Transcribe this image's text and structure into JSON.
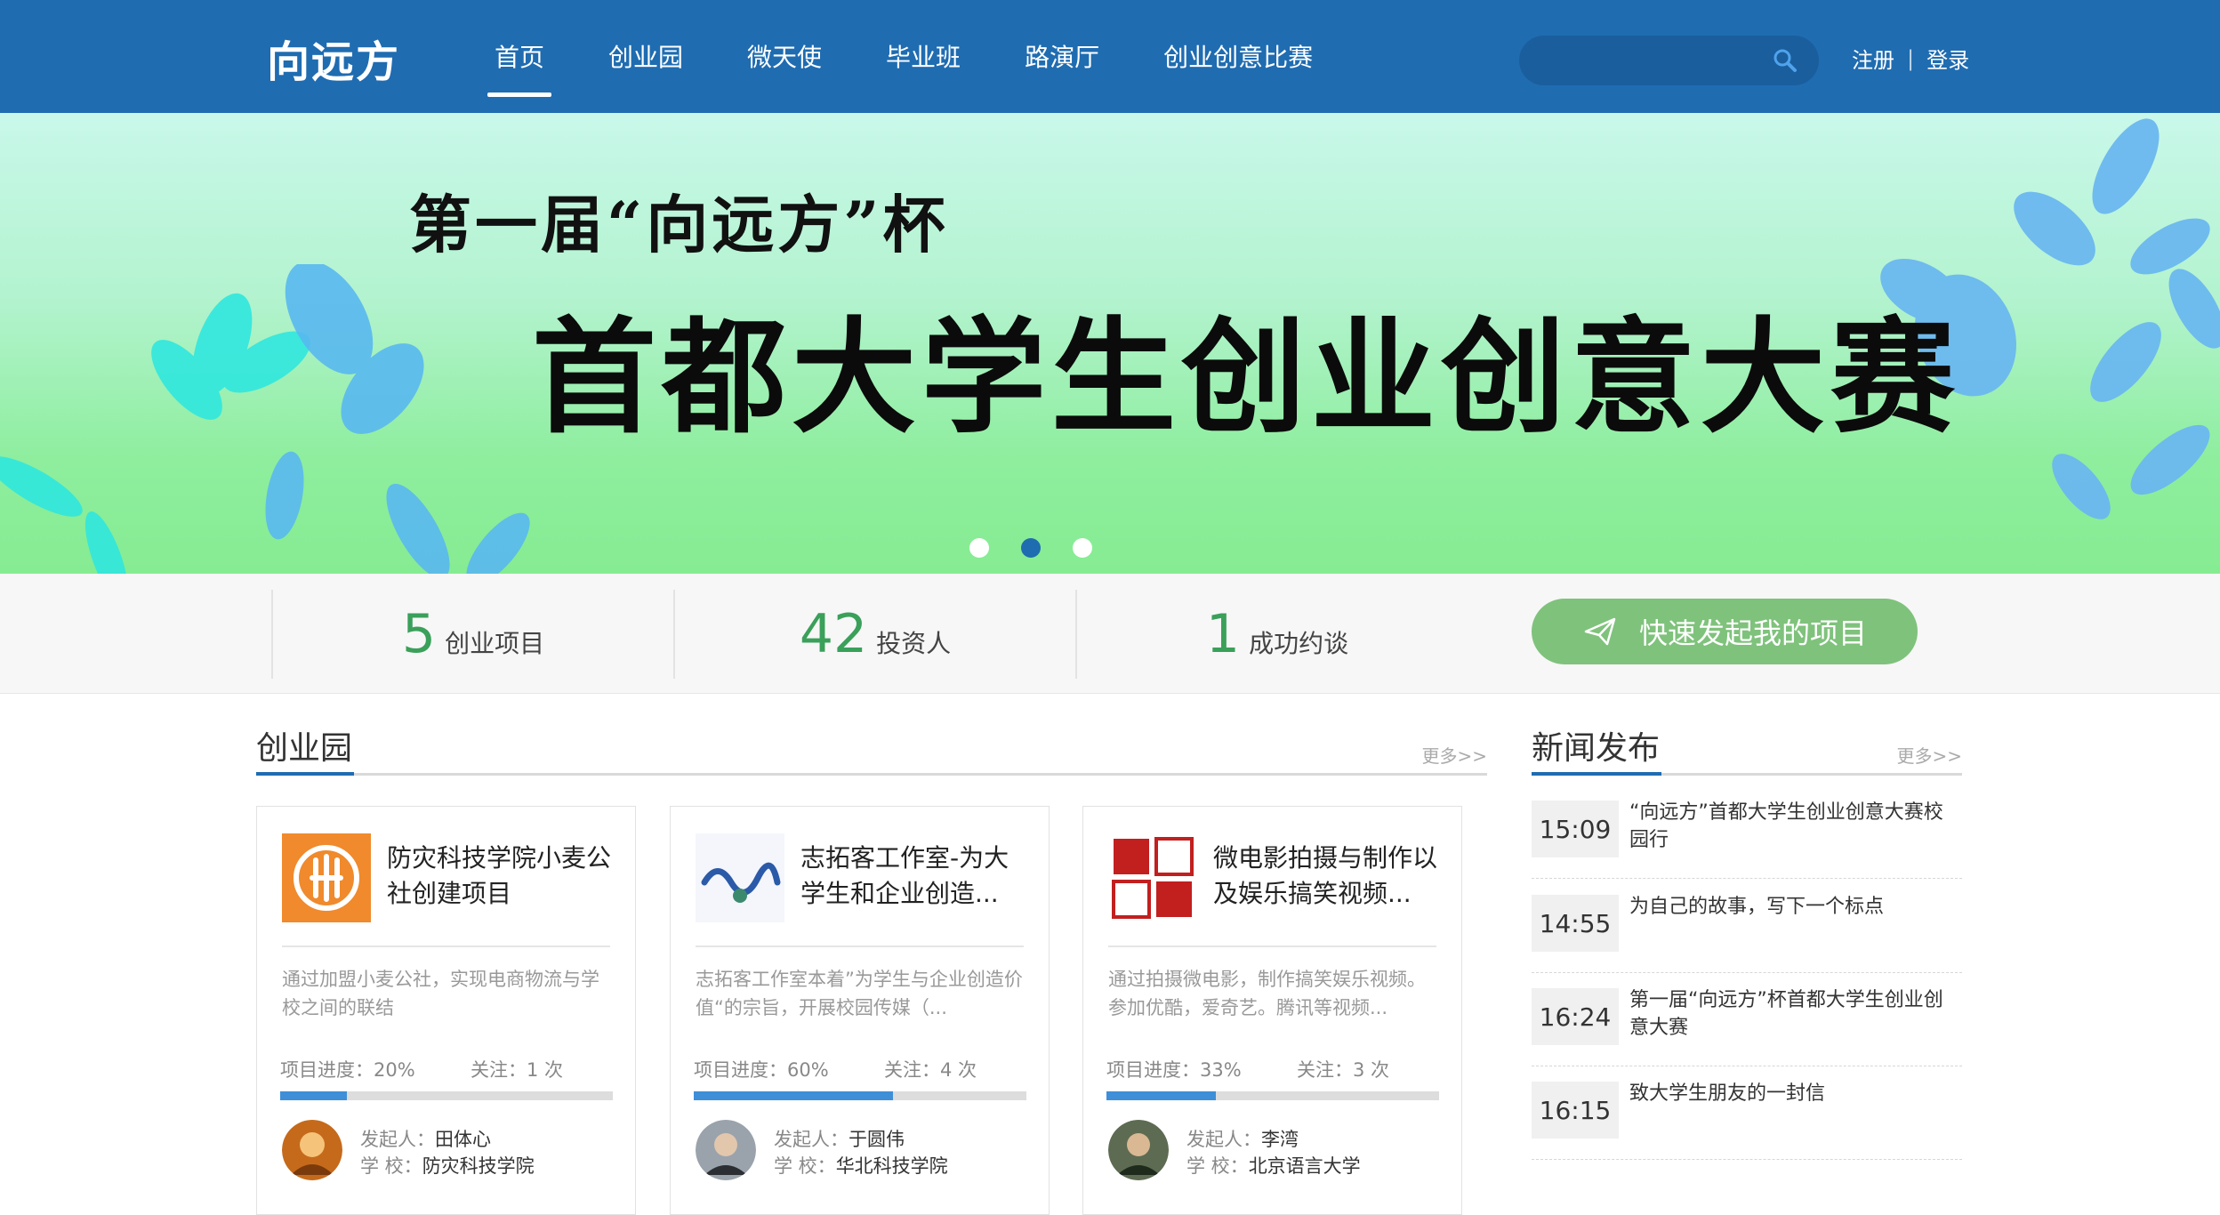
{
  "header": {
    "logo": "向远方",
    "nav": [
      "首页",
      "创业园",
      "微天使",
      "毕业班",
      "路演厅",
      "创业创意比赛"
    ],
    "search_placeholder": "",
    "register": "注册",
    "separator": "|",
    "login": "登录"
  },
  "banner": {
    "subtitle": "第一届“向远方”杯",
    "title": "首都大学生创业创意大赛",
    "slides": 3,
    "active_slide": 2
  },
  "stats": {
    "projects": {
      "num": "5",
      "label": "创业项目"
    },
    "investors": {
      "num": "42",
      "label": "投资人"
    },
    "meetings": {
      "num": "1",
      "label": "成功约谈"
    },
    "cta": "快速发起我的项目"
  },
  "projects_section": {
    "title": "创业园",
    "more": "更多>>"
  },
  "projects": [
    {
      "title": "防灾科技学院小麦公社创建项目",
      "desc": "通过加盟小麦公社，实现电商物流与学校之间的联结",
      "progress_label": "项目进度：20%",
      "progress": 0.2,
      "follow": "关注：1 次",
      "initiator_label": "发起人：",
      "initiator": "田体心",
      "school_label": "学 校：",
      "school": "防灾科技学院",
      "thumb_icon": "wheat-logo-icon",
      "thumb_color": "#f08a2c"
    },
    {
      "title": "志拓客工作室-为大学生和企业创造...",
      "desc": "志拓客工作室本着”为学生与企业创造价值“的宗旨，开展校园传媒（...",
      "progress_label": "项目进度：60%",
      "progress": 0.6,
      "follow": "关注：4 次",
      "initiator_label": "发起人：",
      "initiator": "于圆伟",
      "school_label": "学 校：",
      "school": "华北科技学院",
      "thumb_icon": "calligraphy-logo-icon",
      "thumb_color": "#2b5aa8"
    },
    {
      "title": "微电影拍摄与制作以及娱乐搞笑视频...",
      "desc": "通过拍摄微电影，制作搞笑娱乐视频。参加优酷，爱奇艺。腾讯等视频...",
      "progress_label": "项目进度：33%",
      "progress": 0.33,
      "follow": "关注：3 次",
      "initiator_label": "发起人：",
      "initiator": "李湾",
      "school_label": "学 校：",
      "school": "北京语言大学",
      "thumb_icon": "seal-logo-icon",
      "thumb_color": "#c21f1f"
    }
  ],
  "news_section": {
    "title": "新闻发布",
    "more": "更多>>"
  },
  "news": [
    {
      "time": "15:09",
      "text": "“向远方”首都大学生创业创意大赛校园行"
    },
    {
      "time": "14:55",
      "text": "为自己的故事，写下一个标点"
    },
    {
      "time": "16:24",
      "text": "第一届“向远方”杯首都大学生创业创意大赛"
    },
    {
      "time": "16:15",
      "text": "致大学生朋友的一封信"
    }
  ],
  "colors": {
    "brand": "#1f6cb1",
    "accent_green": "#3aa05a",
    "cta": "#7fc27c",
    "progress": "#3e8fd8"
  }
}
